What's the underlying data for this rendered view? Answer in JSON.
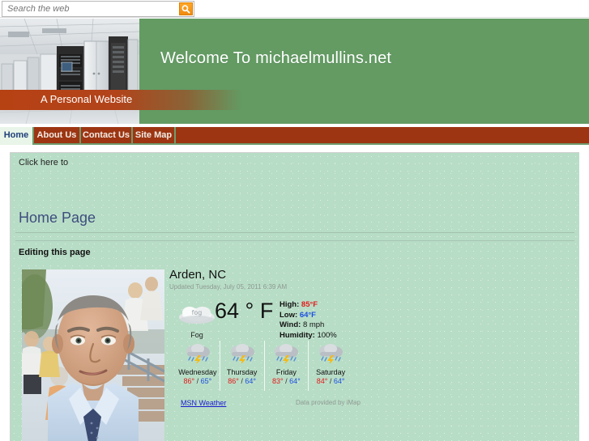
{
  "search": {
    "placeholder": "Search the web",
    "value": "",
    "button_icon": "search-icon"
  },
  "banner": {
    "title": "Welcome To michaelmullins.net",
    "tagline": "A Personal Website",
    "image_alt": "data-center-server-room",
    "green": "#639b63",
    "orange": "#b84212"
  },
  "nav": {
    "items": [
      {
        "label": "Home",
        "active": true
      },
      {
        "label": "About Us",
        "active": false
      },
      {
        "label": "Contact Us",
        "active": false
      },
      {
        "label": "Site Map",
        "active": false
      }
    ]
  },
  "content": {
    "click_here": "Click here to",
    "page_heading": "Home Page",
    "section_heading": "Editing this page",
    "portrait_alt": "portrait-photo-of-man"
  },
  "weather": {
    "city": "Arden, NC",
    "updated": "Updated Tuesday, July 05, 2011 6:39 AM",
    "condition": "Fog",
    "condition_icon": "fog-icon",
    "temperature": "64 ° F",
    "stats": {
      "high_label": "High:",
      "high_value": "85°F",
      "low_label": "Low:",
      "low_value": "64°F",
      "wind_label": "Wind:",
      "wind_value": "8 mph",
      "humidity_label": "Humidity:",
      "humidity_value": "100%"
    },
    "forecast": [
      {
        "day": "Wednesday",
        "icon": "thunderstorm-icon",
        "high": "86°",
        "sep": "/",
        "low": "65°"
      },
      {
        "day": "Thursday",
        "icon": "thunderstorm-icon",
        "high": "86°",
        "sep": "/",
        "low": "64°"
      },
      {
        "day": "Friday",
        "icon": "thunderstorm-icon",
        "high": "83°",
        "sep": "/",
        "low": "64°"
      },
      {
        "day": "Saturday",
        "icon": "thunderstorm-icon",
        "high": "84°",
        "sep": "/",
        "low": "64°"
      }
    ],
    "source_link": "MSN Weather",
    "credit": "Data provided by iMap"
  }
}
